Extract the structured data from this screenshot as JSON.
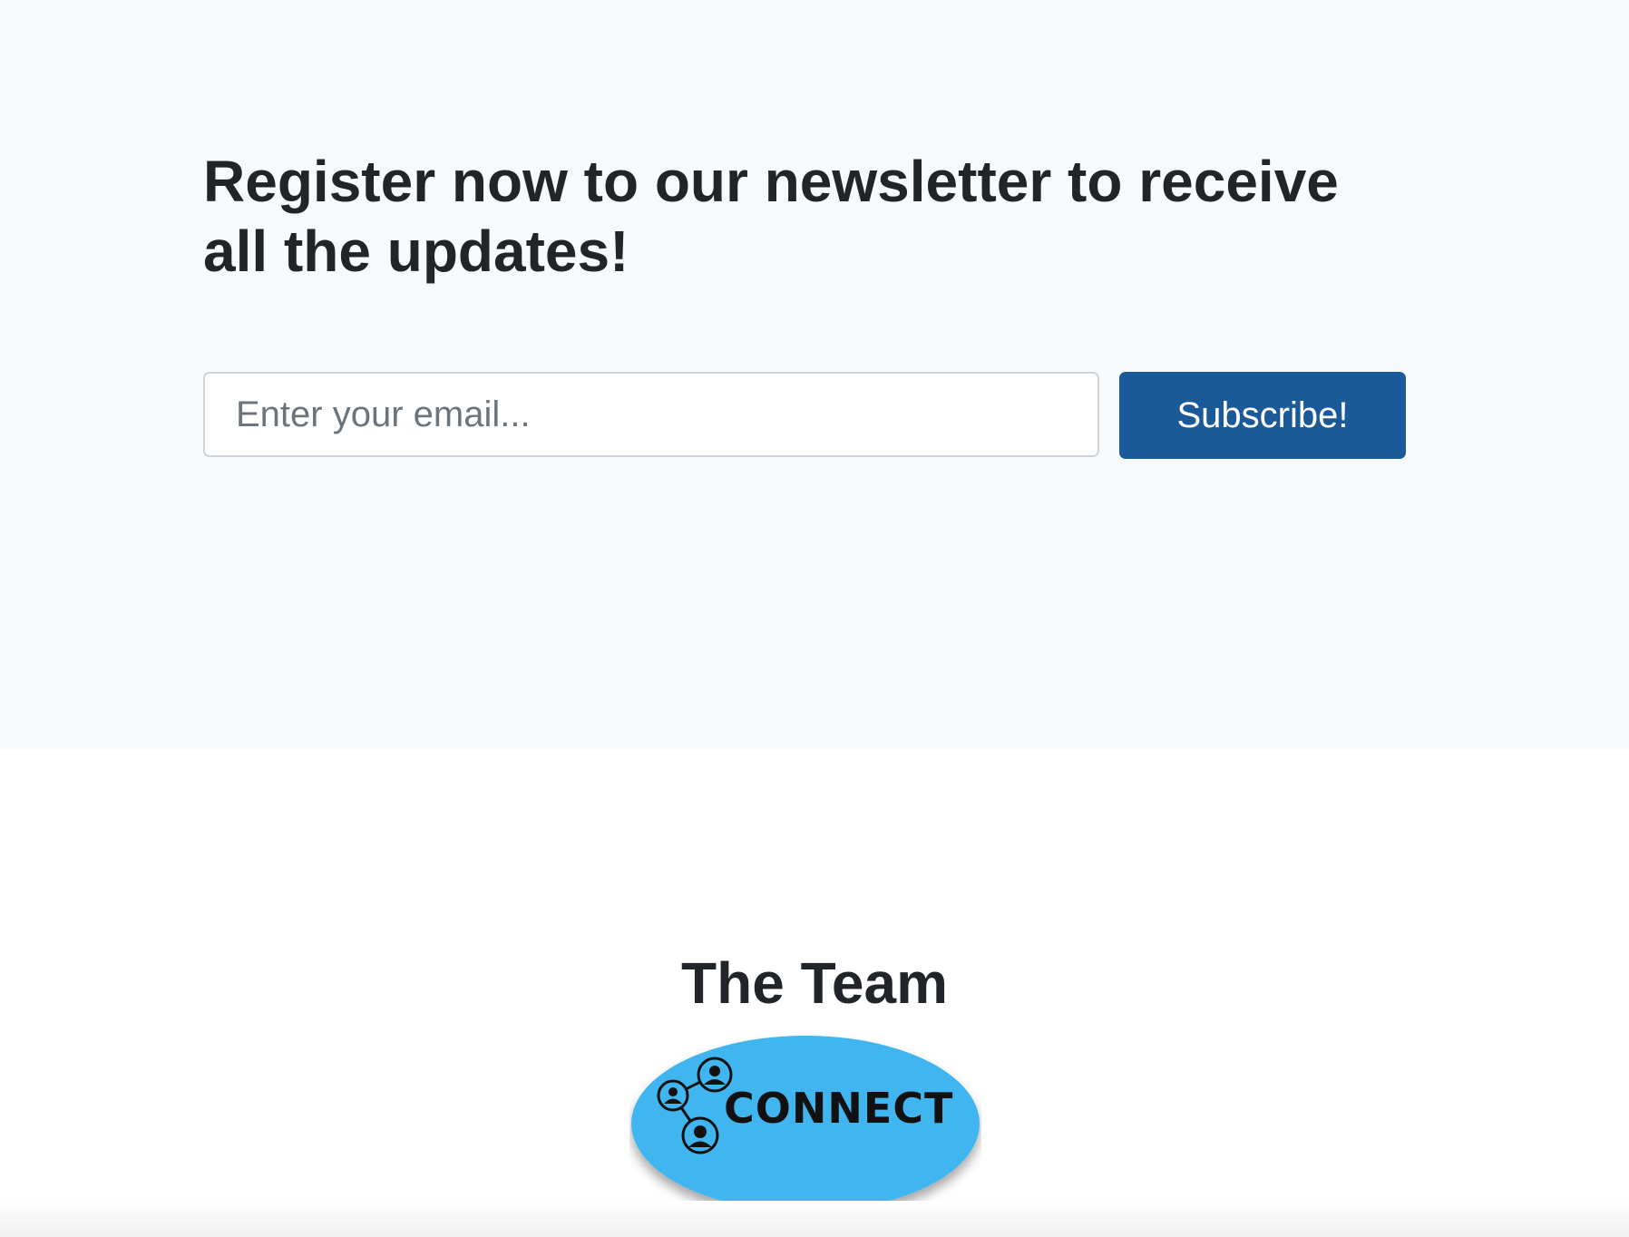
{
  "newsletter": {
    "title": "Register now to our newsletter to receive all the updates!",
    "email_placeholder": "Enter your email...",
    "email_value": "",
    "subscribe_label": "Subscribe!"
  },
  "team": {
    "title": "The Team",
    "logo_text": "CONNECT"
  },
  "colors": {
    "section_bg": "#f8f9fa",
    "button_bg": "#1b5a98",
    "logo_bg": "#41b5ef",
    "text": "#212529"
  }
}
